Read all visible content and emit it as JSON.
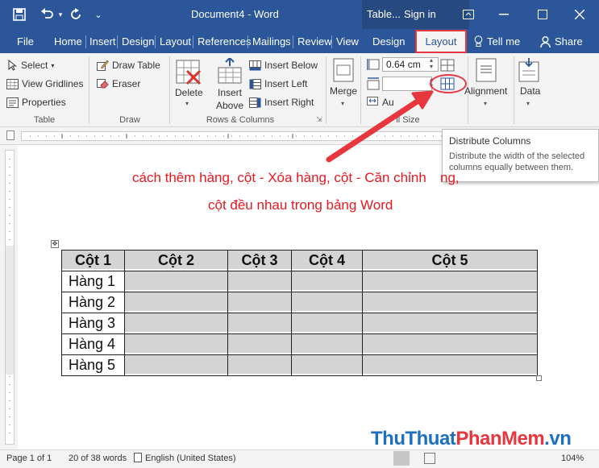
{
  "titlebar": {
    "title": "Document4  -  Word",
    "context_tab": "Table...",
    "sign_in": "Sign in"
  },
  "tabs": {
    "file": "File",
    "home": "Home",
    "insert": "Insert",
    "design": "Design",
    "layout": "Layout",
    "references": "References",
    "mailings": "Mailings",
    "review": "Review",
    "view": "View",
    "table_design": "Design",
    "table_layout": "Layout",
    "tell_me": "Tell me",
    "share": "Share"
  },
  "ribbon": {
    "table_group": {
      "select": "Select",
      "view_gridlines": "View Gridlines",
      "properties": "Properties",
      "label": "Table"
    },
    "draw_group": {
      "draw_table": "Draw Table",
      "eraser": "Eraser",
      "label": "Draw"
    },
    "rows_cols_group": {
      "delete": "Delete",
      "insert_above_1": "Insert",
      "insert_above_2": "Above",
      "insert_below": "Insert Below",
      "insert_left": "Insert Left",
      "insert_right": "Insert Right",
      "label": "Rows & Columns"
    },
    "merge": "Merge",
    "cell_size": {
      "height_value": "0.64 cm",
      "autofit_partial": "Au",
      "label_partial": "ll Size"
    },
    "alignment": "Alignment",
    "data": "Data"
  },
  "tooltip": {
    "title": "Distribute Columns",
    "body": "Distribute the width of the selected columns equally between them."
  },
  "document": {
    "line1": "cách thêm hàng, cột - Xóa hàng, cột - Căn chỉnh",
    "line1_tail": "ng,",
    "line2": "cột đều nhau trong bảng Word",
    "table": {
      "headers": [
        "Cột 1",
        "Cột 2",
        "Cột 3",
        "Cột 4",
        "Cột 5"
      ],
      "rows": [
        "Hàng 1",
        "Hàng 2",
        "Hàng 3",
        "Hàng 4",
        "Hàng 5"
      ]
    }
  },
  "status": {
    "page": "Page 1 of 1",
    "words": "20 of 38 words",
    "language": "English (United States)",
    "zoom": "104%"
  },
  "watermark": {
    "part1": "ThuThuat",
    "part2": "PhanMem",
    "part3": ".vn"
  },
  "colors": {
    "word_blue": "#2b579a",
    "highlight_red": "#e8363f",
    "doc_text_red": "#e8181f"
  }
}
